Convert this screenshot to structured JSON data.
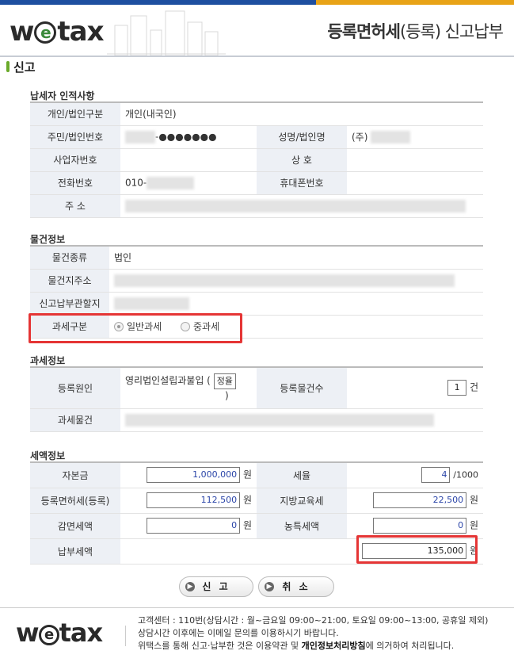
{
  "header": {
    "logo_w": "w",
    "logo_e": "e",
    "logo_rest": "tax",
    "title_bold": "등록면허세",
    "title_light": "(등록) 신고납부"
  },
  "page_title": "신고",
  "taxpayer": {
    "section": "납세자 인적사항",
    "type_label": "개인/법인구분",
    "type_value": "개인(내국인)",
    "id_label": "주민/법인번호",
    "id_masked": "-●●●●●●●",
    "name_label": "성명/법인명",
    "name_prefix": "(주)",
    "biz_label": "사업자번호",
    "trade_label": "상 호",
    "phone_label": "전화번호",
    "phone_prefix": "010-",
    "mobile_label": "휴대폰번호",
    "address_label": "주 소"
  },
  "property": {
    "section": "물건정보",
    "kind_label": "물건종류",
    "kind_value": "법인",
    "addr_label": "물건지주소",
    "office_label": "신고납부관할지",
    "taxtype_label": "과세구분",
    "taxtype_options": [
      "일반과세",
      "중과세"
    ],
    "taxtype_selected": "일반과세"
  },
  "taxinfo": {
    "section": "과세정보",
    "cause_label": "등록원인",
    "cause_value": "영리법인설립과불입 (",
    "cause_box": "정율",
    "cause_close": ")",
    "count_label": "등록물건수",
    "count_value": "1",
    "count_unit": "건",
    "object_label": "과세물건"
  },
  "amounts": {
    "section": "세액정보",
    "capital_label": "자본금",
    "capital_value": "1,000,000",
    "capital_unit": "원",
    "rate_label": "세율",
    "rate_value": "4",
    "rate_unit": "/1000",
    "regtax_label": "등록면허세(등록)",
    "regtax_value": "112,500",
    "regtax_unit": "원",
    "edu_label": "지방교육세",
    "edu_value": "22,500",
    "edu_unit": "원",
    "reduce_label": "감면세액",
    "reduce_value": "0",
    "reduce_unit": "원",
    "rural_label": "농특세액",
    "rural_value": "0",
    "rural_unit": "원",
    "total_label": "납부세액",
    "total_value": "135,000",
    "total_unit": "원"
  },
  "buttons": {
    "submit": "신 고",
    "cancel": "취 소"
  },
  "footer": {
    "line1": "고객센터 : 110번(상담시간 : 월~금요일 09:00~21:00, 토요일 09:00~13:00, 공휴일 제외)",
    "line2": "상담시간 이후에는 이메일 문의를 이용하시기 바랍니다.",
    "line3_a": "위택스를 통해 신고·납부한 것은 이용약관 및 ",
    "line3_b": "개인정보처리방침",
    "line3_c": "에 의거하여 처리됩니다."
  },
  "colors": {
    "accent": "#1e4fa0",
    "highlight": "#e53535",
    "label_bg": "#edf0f5"
  }
}
